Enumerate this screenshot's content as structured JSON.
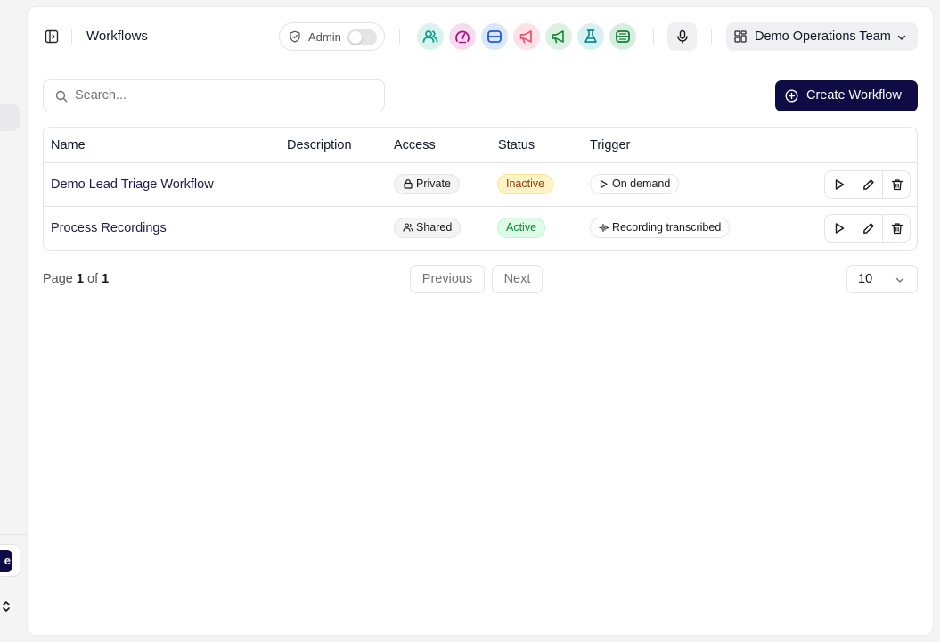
{
  "header": {
    "title": "Workflows",
    "admin_label": "Admin",
    "admin_enabled": false,
    "app_icons": [
      {
        "name": "users-icon",
        "color": "#0f9f8f",
        "bg": "#d9f3ef"
      },
      {
        "name": "gauge-icon",
        "color": "#b0168b",
        "bg": "#f6dcef"
      },
      {
        "name": "server-icon",
        "color": "#1d5be0",
        "bg": "#dbe6fb"
      },
      {
        "name": "megaphone-icon",
        "color": "#f0506e",
        "bg": "#fde1e6"
      },
      {
        "name": "megaphone-icon",
        "color": "#1a8a3c",
        "bg": "#dcf1e1"
      },
      {
        "name": "flask-icon",
        "color": "#0f8a8a",
        "bg": "#d8f0f0"
      },
      {
        "name": "database-icon",
        "color": "#1a7a3a",
        "bg": "#d6eedd"
      }
    ],
    "team_name": "Demo Operations Team"
  },
  "toolbar": {
    "search_placeholder": "Search...",
    "search_value": "",
    "create_label": "Create Workflow",
    "accent": "#0e0b45"
  },
  "table": {
    "columns": [
      "Name",
      "Description",
      "Access",
      "Status",
      "Trigger"
    ],
    "rows": [
      {
        "name": "Demo Lead Triage Workflow",
        "description": "",
        "access": "Private",
        "access_icon": "lock-icon",
        "status": "Inactive",
        "trigger": "On demand",
        "trigger_icon": "play-icon"
      },
      {
        "name": "Process Recordings",
        "description": "",
        "access": "Shared",
        "access_icon": "users-icon",
        "status": "Active",
        "trigger": "Recording transcribed",
        "trigger_icon": "audio-wave-icon"
      }
    ]
  },
  "pagination": {
    "page_prefix": "Page",
    "current": "1",
    "of": "of",
    "total": "1",
    "previous_label": "Previous",
    "next_label": "Next",
    "page_size": "10"
  },
  "sidebar": {
    "partial_button_text": "e"
  }
}
